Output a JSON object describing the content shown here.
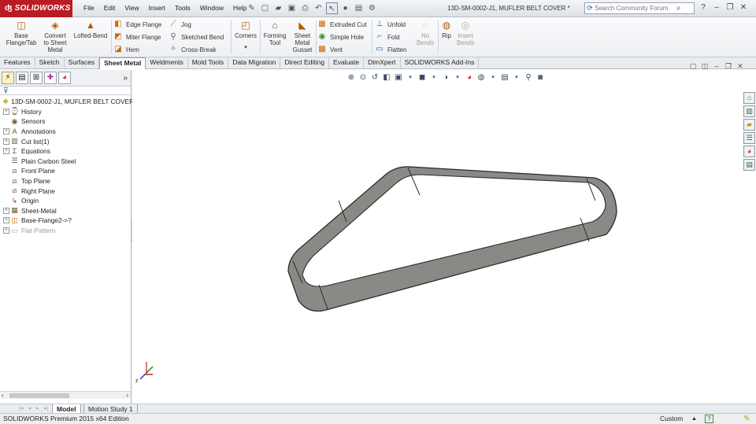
{
  "app": {
    "brand": "SOLIDWORKS",
    "document_title": "13D-SM-0002-J1, MUFLER BELT COVER *"
  },
  "menu": [
    "File",
    "Edit",
    "View",
    "Insert",
    "Tools",
    "Window",
    "Help"
  ],
  "search": {
    "placeholder": "Search Community Forum"
  },
  "ribbon": {
    "base_flange": "Base\nFlange/Tab",
    "convert": "Convert\nto Sheet\nMetal",
    "lofted_bend": "Lofted-Bend",
    "edge_flange": "Edge Flange",
    "miter_flange": "Miter Flange",
    "hem": "Hem",
    "jog": "Jog",
    "sketched_bend": "Sketched Bend",
    "cross_break": "Cross-Break",
    "corners": "Corners",
    "forming_tool": "Forming\nTool",
    "gusset": "Sheet\nMetal\nGusset",
    "extruded_cut": "Extruded Cut",
    "simple_hole": "Simple Hole",
    "vent": "Vent",
    "unfold": "Unfold",
    "fold": "Fold",
    "flatten": "Flatten",
    "no_bends": "No\nBends",
    "rip": "Rip",
    "insert_bends": "Insert\nBends"
  },
  "command_tabs": [
    "Features",
    "Sketch",
    "Surfaces",
    "Sheet Metal",
    "Weldments",
    "Mold Tools",
    "Data Migration",
    "Direct Editing",
    "Evaluate",
    "DimXpert",
    "SOLIDWORKS Add-Ins"
  ],
  "active_command_tab": "Sheet Metal",
  "tree": {
    "root": "13D-SM-0002-J1, MUFLER BELT COVER",
    "items": [
      {
        "label": "History",
        "icon": "history-icon",
        "expandable": true
      },
      {
        "label": "Sensors",
        "icon": "sensor-icon",
        "expandable": false
      },
      {
        "label": "Annotations",
        "icon": "annotations-icon",
        "expandable": true
      },
      {
        "label": "Cut list(1)",
        "icon": "cut-list-icon",
        "expandable": true
      },
      {
        "label": "Equations",
        "icon": "equations-icon",
        "expandable": true
      },
      {
        "label": "Plain Carbon Steel",
        "icon": "material-icon",
        "expandable": false
      },
      {
        "label": "Front Plane",
        "icon": "plane-icon",
        "expandable": false
      },
      {
        "label": "Top Plane",
        "icon": "plane-icon",
        "expandable": false
      },
      {
        "label": "Right Plane",
        "icon": "plane-icon",
        "expandable": false
      },
      {
        "label": "Origin",
        "icon": "origin-icon",
        "expandable": false
      },
      {
        "label": "Sheet-Metal",
        "icon": "sheet-metal-icon",
        "expandable": true
      },
      {
        "label": "Base-Flange2->?",
        "icon": "base-flange-icon",
        "expandable": true
      },
      {
        "label": "Flat-Pattern",
        "icon": "flat-pattern-icon",
        "expandable": true,
        "dim": true
      }
    ]
  },
  "model_tabs": [
    "Model",
    "Motion Study 1"
  ],
  "triad_axis": "z",
  "status": {
    "left": "SOLIDWORKS Premium 2015 x64 Edition",
    "units": "Custom"
  }
}
